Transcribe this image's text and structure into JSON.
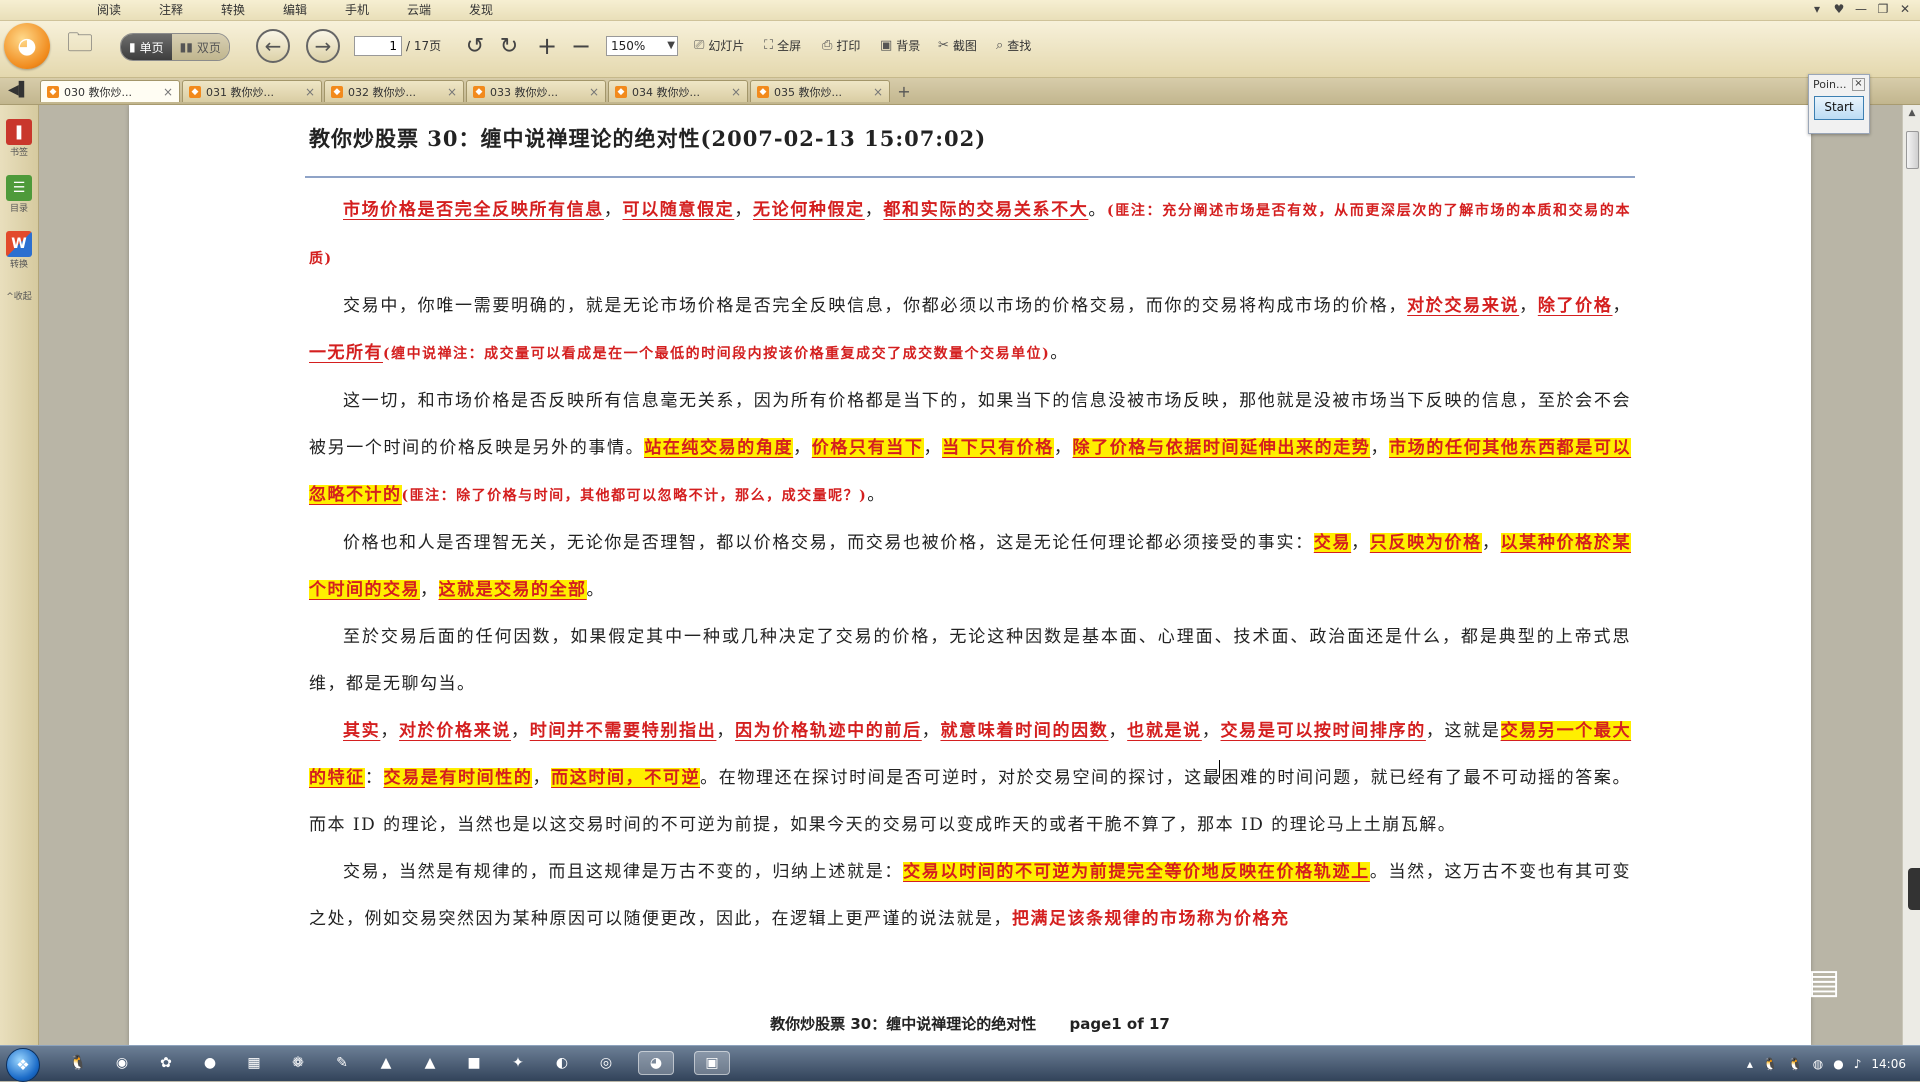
{
  "menu": [
    "阅读",
    "注释",
    "转换",
    "编辑",
    "手机",
    "云端",
    "发现"
  ],
  "window_controls": [
    "▾",
    "♥",
    "—",
    "❐",
    "✕"
  ],
  "toolbar": {
    "single_page": "单页",
    "double_page": "双页",
    "page_current": "1",
    "page_total": "/ 17页",
    "zoom": "150%",
    "slideshow": "幻灯片",
    "fullscreen": "全屏",
    "print": "打印",
    "background": "背景",
    "screenshot": "截图",
    "find": "查找"
  },
  "tabs": [
    {
      "title": "030 教你炒..."
    },
    {
      "title": "031 教你炒..."
    },
    {
      "title": "032 教你炒..."
    },
    {
      "title": "033 教你炒..."
    },
    {
      "title": "034 教你炒..."
    },
    {
      "title": "035 教你炒..."
    }
  ],
  "sidebar": {
    "bookmark": "书签",
    "toc": "目录",
    "convert": "转换",
    "collapse": "^收起"
  },
  "point_widget": {
    "title": "Poin...",
    "start": "Start"
  },
  "doc": {
    "title": "教你炒股票 30：缠中说禅理论的绝对性(2007-02-13 15:07:02)",
    "p1": {
      "a": "市场价格是否完全反映所有信息",
      "b": "，",
      "c": "可以随意假定",
      "d": "，",
      "e": "无论何种假定",
      "f": "，",
      "g": "都和实际的交易关系不大",
      "h": "。",
      "note": "(匪注：充分阐述市场是否有效，从而更深层次的了解市场的本质和交易的本质)"
    },
    "p2": {
      "a": "交易中，你唯一需要明确的，就是无论市场价格是否完全反映信息，你都必须以市场的价格交易，而你的交易将构成市场的价格，",
      "b": "对於交易来说",
      "c": "，",
      "d": "除了价格",
      "e": "，",
      "f": "一无所有",
      "note": "(缠中说禅注：成交量可以看成是在一个最低的时间段内按该价格重复成交了成交数量个交易单位)",
      "g": "。"
    },
    "p3": {
      "a": "这一切，和市场价格是否反映所有信息毫无关系，因为所有价格都是当下的，如果当下的信息没被市场反映，那他就是没被市场当下反映的信息，至於会不会被另一个时间的价格反映是另外的事情。",
      "b": "站在纯交易的角度",
      "c": "，",
      "d": "价格只有当下",
      "e": "，",
      "f": "当下只有价格",
      "g": "，",
      "h": "除了价格与依据时间延伸出来的走势",
      "i": "，",
      "j": "市场的任何其他东西都是可以忽略不计的",
      "note": "(匪注：除了价格与时间，其他都可以忽略不计，那么，成交量呢？)",
      "k": "。"
    },
    "p4": {
      "a": "价格也和人是否理智无关，无论你是否理智，都以价格交易，而交易也被价格，这是无论任何理论都必须接受的事实：",
      "b": "交易",
      "c": "，",
      "d": "只反映为价格",
      "e": "，",
      "f": "以某种价格於某个时间的交易",
      "g": "，",
      "h": "这就是交易的全部",
      "i": "。"
    },
    "p5": "至於交易后面的任何因数，如果假定其中一种或几种决定了交易的价格，无论这种因数是基本面、心理面、技术面、政治面还是什么，都是典型的上帝式思维，都是无聊勾当。",
    "p6": {
      "a": "其实",
      "b": "，",
      "c": "对於价格来说",
      "d": "，",
      "e": "时间并不需要特别指出",
      "f": "，",
      "g": "因为价格轨迹中的前后",
      "h": "，",
      "i": "就意味着时间的因数",
      "j": "，",
      "k": "也就是说",
      "l": "，",
      "m": "交易是可以按时间排序的",
      "n": "，这就是",
      "o": "交易另一个最大的特征",
      "p": "：",
      "q": "交易是有时间性的",
      "r": "，",
      "s": "而这时间，不可逆",
      "t": "。在物理还在探讨时间是否可逆时，对於交易空间的探讨，这最困难的时间问题，就已经有了最不可动摇的答案。而本 ID 的理论，当然也是以这交易时间的不可逆为前提，如果今天的交易可以变成昨天的或者干脆不算了，那本 ID 的理论马上土崩瓦解。"
    },
    "p7": {
      "a": "交易，当然是有规律的，而且这规律是万古不变的，归纳上述就是：",
      "b": "交易以时间的不可逆为前提完全等价地反映在价格轨迹上",
      "c": "。当然，这万古不变也有其可变之处，例如交易突然因为某种原因可以随便更改，因此，在逻辑上更严谨的说法就是，",
      "d": "把满足该条规律的市场称为价格充"
    },
    "footer_title": "教你炒股票 30：缠中说禅理论的绝对性",
    "footer_page": "page1 of 17"
  },
  "taskbar": {
    "clock": "14:06"
  },
  "colors": {
    "accent_red": "#d41f1f",
    "highlight_yellow": "#ffef00",
    "toolbar_bg": "#e9dfb9"
  }
}
